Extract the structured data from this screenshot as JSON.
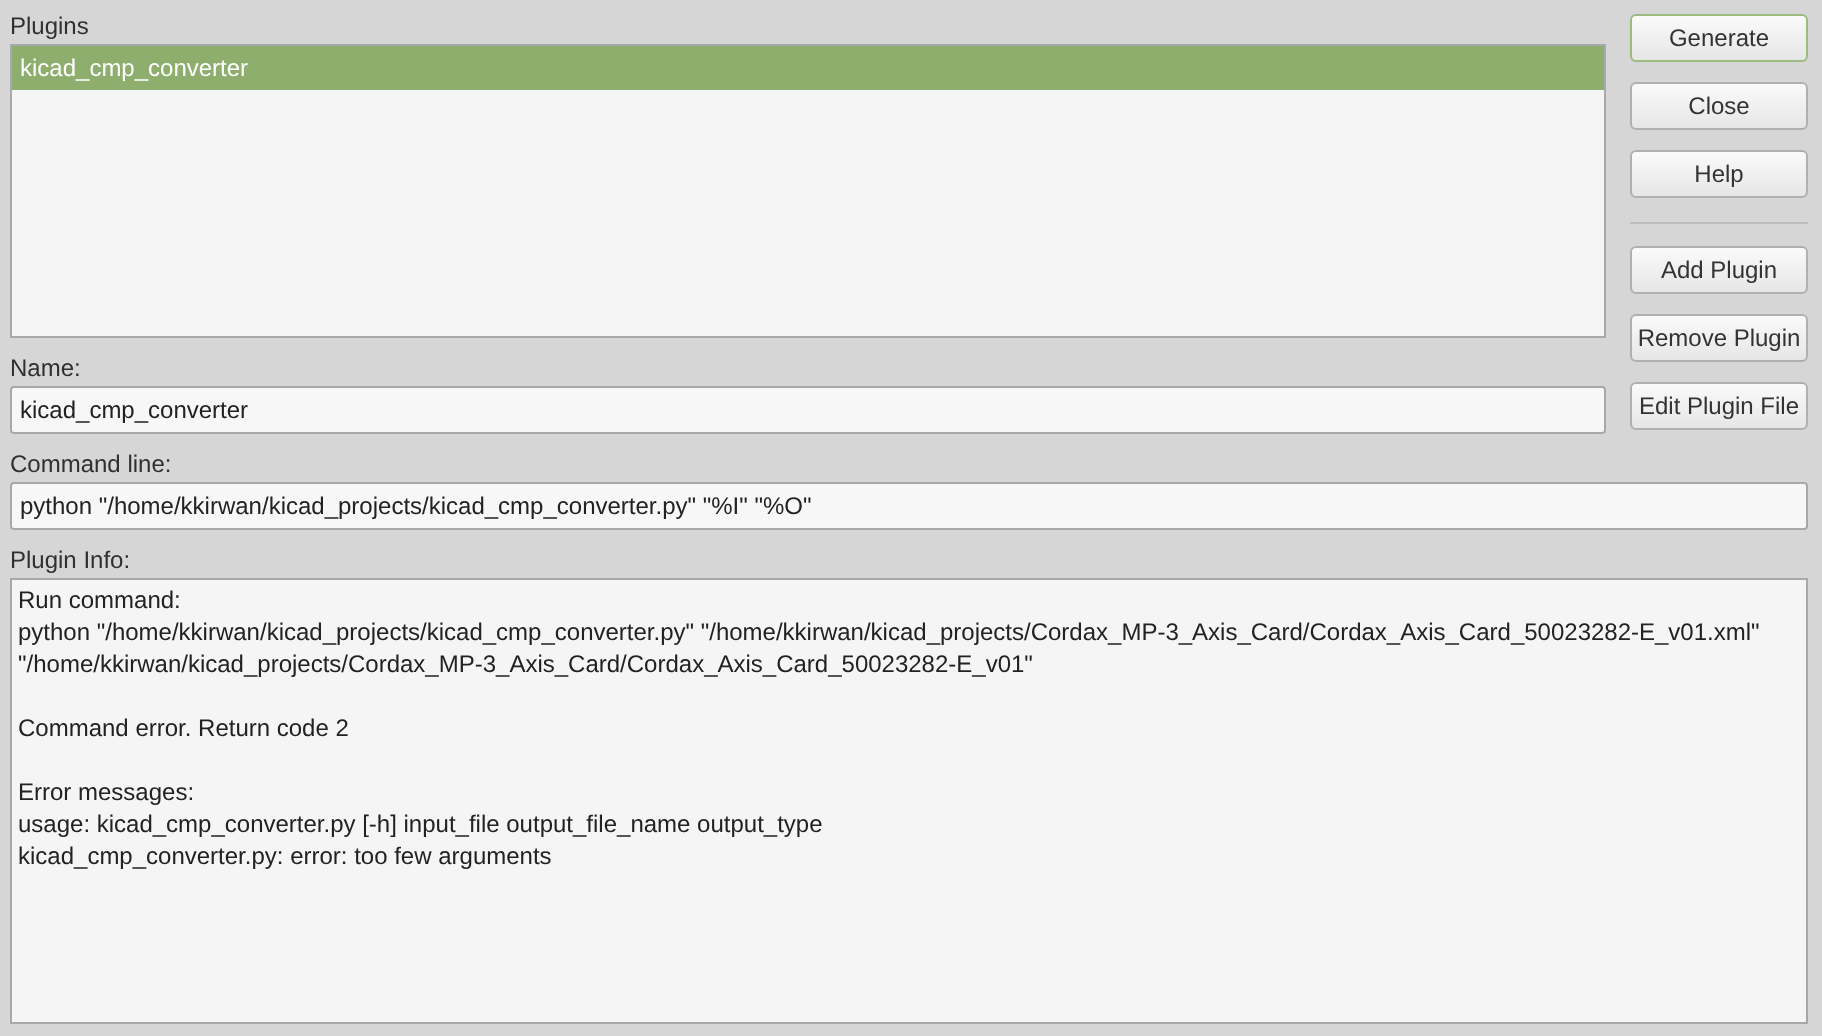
{
  "plugins": {
    "label": "Plugins",
    "items": [
      {
        "name": "kicad_cmp_converter",
        "selected": true
      }
    ]
  },
  "name": {
    "label": "Name:",
    "value": "kicad_cmp_converter"
  },
  "command_line": {
    "label": "Command line:",
    "value": "python \"/home/kkirwan/kicad_projects/kicad_cmp_converter.py\" \"%I\" \"%O\""
  },
  "plugin_info": {
    "label": "Plugin Info:",
    "paragraphs": [
      [
        "Run command:",
        "python \"/home/kkirwan/kicad_projects/kicad_cmp_converter.py\" \"/home/kkirwan/kicad_projects/Cordax_MP-3_Axis_Card/Cordax_Axis_Card_50023282-E_v01.xml\"",
        "\"/home/kkirwan/kicad_projects/Cordax_MP-3_Axis_Card/Cordax_Axis_Card_50023282-E_v01\""
      ],
      [
        "Command error. Return code 2"
      ],
      [
        "Error messages:",
        "usage: kicad_cmp_converter.py [-h] input_file output_file_name output_type",
        "kicad_cmp_converter.py: error: too few arguments"
      ]
    ]
  },
  "buttons": [
    {
      "label": "Generate",
      "kind": "default"
    },
    {
      "label": "Close",
      "kind": "normal"
    },
    {
      "label": "Help",
      "kind": "normal"
    },
    {
      "kind": "separator"
    },
    {
      "label": "Add Plugin",
      "kind": "normal"
    },
    {
      "label": "Remove Plugin",
      "kind": "normal"
    },
    {
      "label": "Edit Plugin File",
      "kind": "normal"
    }
  ]
}
